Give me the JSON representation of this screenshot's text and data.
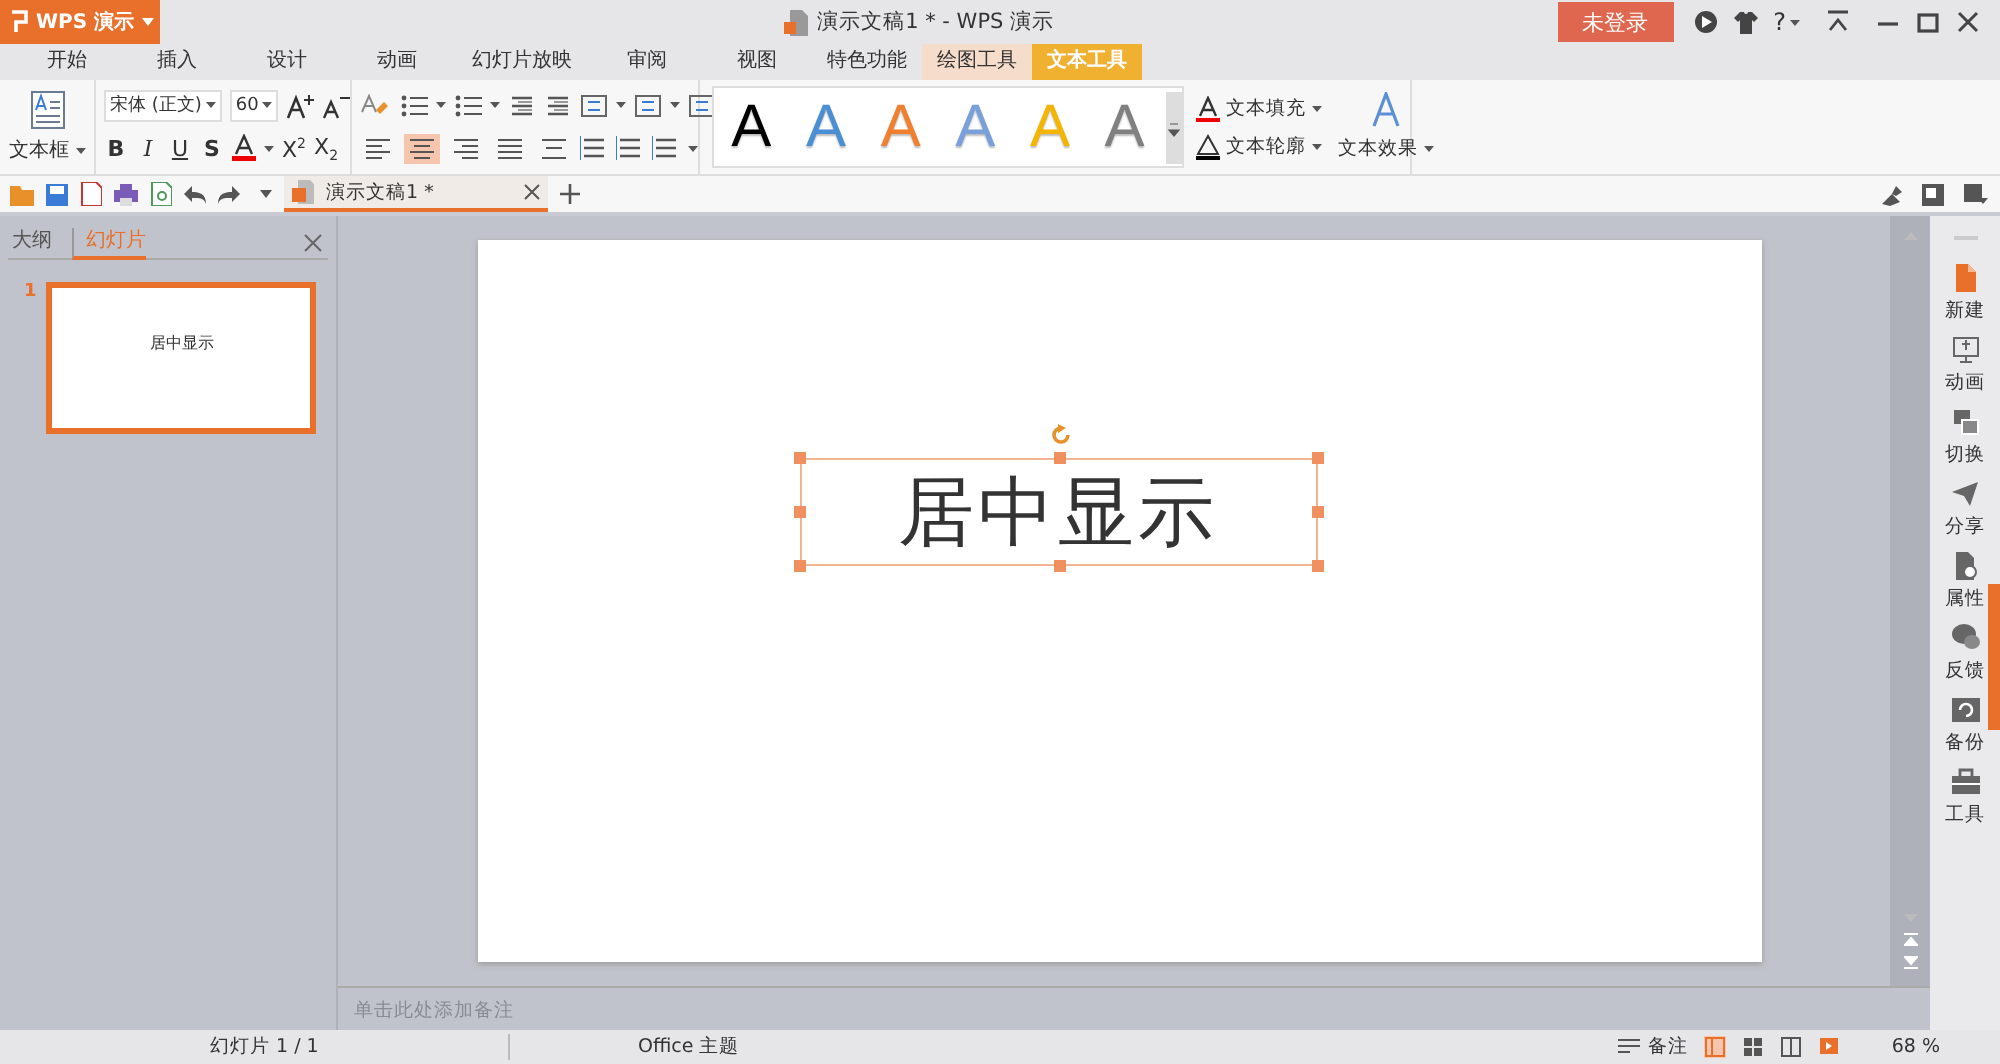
{
  "app_menu": {
    "label": "WPS 演示"
  },
  "window_title": "演示文稿1 * - WPS 演示",
  "login_button": "未登录",
  "help_button": "?",
  "ribbon_tabs": [
    {
      "label": "开始",
      "kind": "normal",
      "selected": false
    },
    {
      "label": "插入",
      "kind": "normal",
      "selected": false
    },
    {
      "label": "设计",
      "kind": "normal",
      "selected": false
    },
    {
      "label": "动画",
      "kind": "normal",
      "selected": false
    },
    {
      "label": "幻灯片放映",
      "kind": "normal",
      "selected": false
    },
    {
      "label": "审阅",
      "kind": "normal",
      "selected": false
    },
    {
      "label": "视图",
      "kind": "normal",
      "selected": false
    },
    {
      "label": "特色功能",
      "kind": "normal",
      "selected": false
    },
    {
      "label": "绘图工具",
      "kind": "context",
      "selected": false
    },
    {
      "label": "文本工具",
      "kind": "context",
      "selected": true
    }
  ],
  "ribbon": {
    "textbox_button": "文本框",
    "font_name": "宋体 (正文)",
    "font_size": "60",
    "format_buttons": [
      {
        "label": "B",
        "kind": "bold"
      },
      {
        "label": "I",
        "kind": "italic"
      },
      {
        "label": "U",
        "kind": "underline"
      },
      {
        "label": "S",
        "kind": "shadow"
      }
    ],
    "script_buttons": [
      "X$^{2}$",
      "X$_{2}$"
    ],
    "alignment": [
      {
        "selected": false
      },
      {
        "selected": true
      },
      {
        "selected": false
      },
      {
        "selected": false
      },
      {
        "selected": false
      }
    ],
    "style_gallery": [
      {
        "label": "A",
        "color": "#000000"
      },
      {
        "label": "A",
        "color": "#4a8fd4"
      },
      {
        "label": "A",
        "color": "#f07f30"
      },
      {
        "label": "A",
        "color": "#7aa0dc"
      },
      {
        "label": "A",
        "color": "#f5b400"
      },
      {
        "label": "A",
        "color": "#808080"
      }
    ],
    "text_fill": "文本填充",
    "text_outline": "文本轮廓",
    "text_effects": "文本效果"
  },
  "document_tab": {
    "label": "演示文稿1 *",
    "selected": true
  },
  "side_panel": {
    "tabs": [
      {
        "label": "大纲",
        "selected": false
      },
      {
        "label": "幻灯片",
        "selected": true
      }
    ],
    "slides": [
      {
        "number": "1",
        "text": "居中显示",
        "selected": true
      }
    ]
  },
  "slide": {
    "text": "居中显示",
    "selected": true
  },
  "right_sidebar": [
    {
      "label": "新建",
      "kind": "new"
    },
    {
      "label": "动画",
      "kind": "animation"
    },
    {
      "label": "切换",
      "kind": "transition"
    },
    {
      "label": "分享",
      "kind": "share"
    },
    {
      "label": "属性",
      "kind": "properties"
    },
    {
      "label": "反馈",
      "kind": "feedback"
    },
    {
      "label": "备份",
      "kind": "backup"
    },
    {
      "label": "工具",
      "kind": "tools"
    }
  ],
  "notes_placeholder": "单击此处添加备注",
  "status_bar": {
    "slide_count": "幻灯片 1 / 1",
    "theme": "Office 主题",
    "notes_button": "备注",
    "view_buttons": [
      {
        "selected": true
      },
      {
        "selected": false
      },
      {
        "selected": false
      },
      {
        "selected": false
      }
    ],
    "zoom": "68 %"
  }
}
